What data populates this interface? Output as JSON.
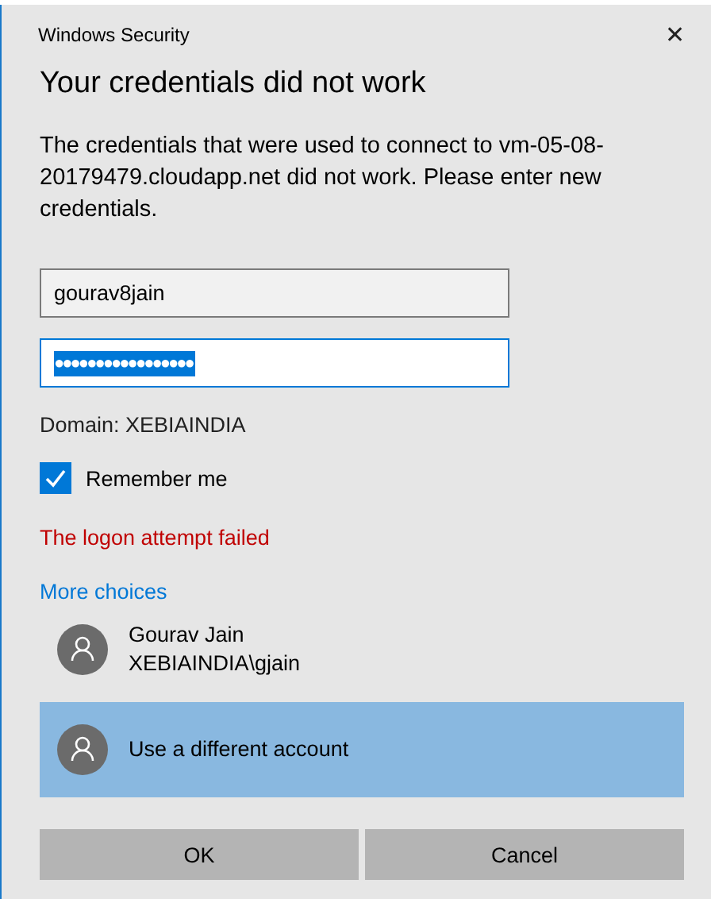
{
  "window": {
    "title": "Windows Security",
    "close": "✕"
  },
  "heading": "Your credentials did not work",
  "message": "The credentials that were used to connect to vm-05-08-20179479.cloudapp.net did not work. Please enter new credentials.",
  "username": {
    "value": "gourav8jain"
  },
  "password": {
    "value": "●●●●●●●●●●●●●●●●●",
    "text_selected": true,
    "focused": true
  },
  "domain": "Domain: XEBIAINDIA",
  "remember": {
    "label": "Remember me",
    "checked": true
  },
  "error": "The logon attempt failed",
  "more_choices": "More choices",
  "accounts": [
    {
      "lines": [
        "Gourav Jain",
        "XEBIAINDIA\\gjain"
      ],
      "selected": false
    },
    {
      "lines": [
        "Use a different account"
      ],
      "selected": true
    }
  ],
  "buttons": [
    "OK",
    "Cancel"
  ]
}
